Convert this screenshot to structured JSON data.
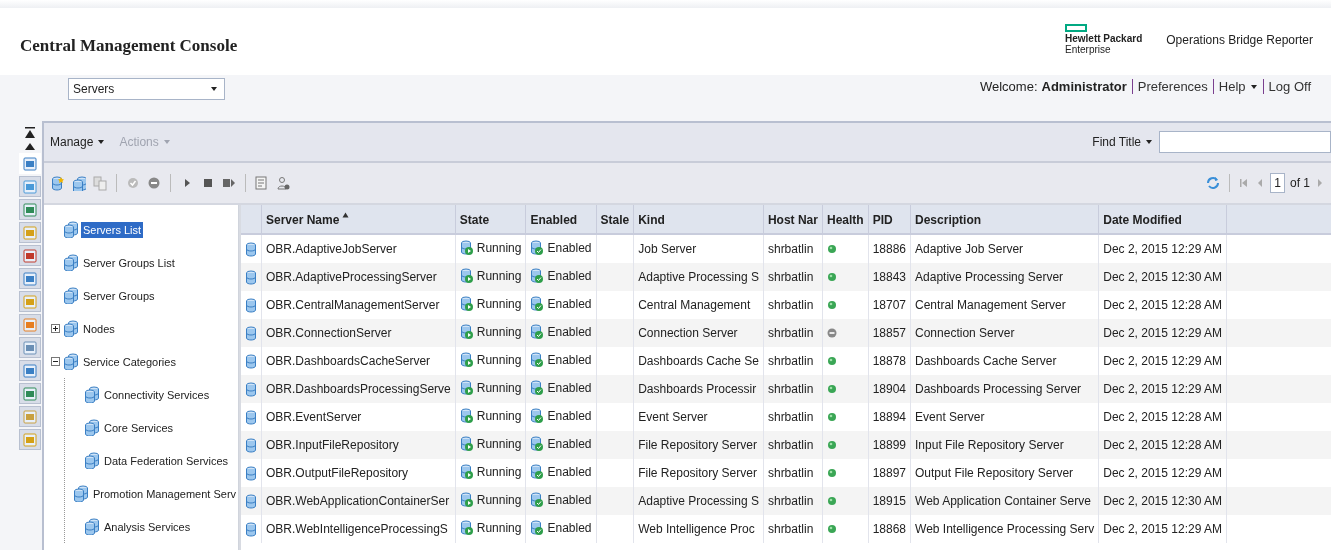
{
  "header": {
    "title": "Central Management Console",
    "brand_lines": [
      "Hewlett Packard",
      "Enterprise"
    ],
    "product": "Operations Bridge Reporter"
  },
  "area_select": {
    "value": "Servers"
  },
  "user_bar": {
    "welcome": "Welcome:",
    "user": "Administrator",
    "links": [
      {
        "label": "Preferences",
        "menu": false
      },
      {
        "label": "Help",
        "menu": true
      },
      {
        "label": "Log Off",
        "menu": false
      }
    ]
  },
  "menus": [
    {
      "label": "Manage",
      "disabled": false
    },
    {
      "label": "Actions",
      "disabled": true
    }
  ],
  "find": {
    "label": "Find Title"
  },
  "pager": {
    "page": "1",
    "total": "of 1"
  },
  "side_tabs": [
    {
      "selected": true
    },
    {
      "selected": false
    },
    {
      "selected": false
    },
    {
      "selected": false
    },
    {
      "selected": false
    },
    {
      "selected": false
    },
    {
      "selected": false
    },
    {
      "selected": false
    },
    {
      "selected": false
    },
    {
      "selected": false
    },
    {
      "selected": false
    },
    {
      "selected": false
    },
    {
      "selected": false
    }
  ],
  "tree": [
    {
      "label": "Servers List",
      "selected": true
    },
    {
      "label": "Server Groups List",
      "selected": false
    },
    {
      "label": "Server Groups",
      "selected": false
    },
    {
      "label": "Nodes",
      "selected": false,
      "expanded": false
    },
    {
      "label": "Service Categories",
      "selected": false,
      "expanded": true,
      "children": [
        {
          "label": "Connectivity Services",
          "selected": false
        },
        {
          "label": "Core Services",
          "selected": false
        },
        {
          "label": "Data Federation Services",
          "selected": false
        },
        {
          "label": "Promotion Management Serv",
          "selected": false
        },
        {
          "label": "Analysis Services",
          "selected": false
        }
      ]
    }
  ],
  "table": {
    "columns": [
      {
        "label": "Server Name",
        "sorted": true
      },
      {
        "label": "State"
      },
      {
        "label": "Enabled"
      },
      {
        "label": "Stale"
      },
      {
        "label": "Kind"
      },
      {
        "label": "Host Nar"
      },
      {
        "label": "Health"
      },
      {
        "label": "PID"
      },
      {
        "label": "Description"
      },
      {
        "label": "Date Modified"
      }
    ],
    "rows": [
      {
        "name": "OBR.AdaptiveJobServer",
        "state": "Running",
        "enabled": "Enabled",
        "kind": "Job Server",
        "host": "shrbatlin",
        "healthy": true,
        "pid": "18886",
        "description": "Adaptive Job Server",
        "modified": "Dec 2, 2015 12:29 AM"
      },
      {
        "name": "OBR.AdaptiveProcessingServer",
        "state": "Running",
        "enabled": "Enabled",
        "kind": "Adaptive Processing S",
        "host": "shrbatlin",
        "healthy": true,
        "pid": "18843",
        "description": "Adaptive Processing Server",
        "modified": "Dec 2, 2015 12:30 AM"
      },
      {
        "name": "OBR.CentralManagementServer",
        "state": "Running",
        "enabled": "Enabled",
        "kind": "Central Management",
        "host": "shrbatlin",
        "healthy": true,
        "pid": "18707",
        "description": "Central Management Server",
        "modified": "Dec 2, 2015 12:28 AM"
      },
      {
        "name": "OBR.ConnectionServer",
        "state": "Running",
        "enabled": "Enabled",
        "kind": "Connection Server",
        "host": "shrbatlin",
        "healthy": false,
        "pid": "18857",
        "description": "Connection Server",
        "modified": "Dec 2, 2015 12:29 AM"
      },
      {
        "name": "OBR.DashboardsCacheServer",
        "state": "Running",
        "enabled": "Enabled",
        "kind": "Dashboards Cache Se",
        "host": "shrbatlin",
        "healthy": true,
        "pid": "18878",
        "description": "Dashboards Cache Server",
        "modified": "Dec 2, 2015 12:29 AM"
      },
      {
        "name": "OBR.DashboardsProcessingServe",
        "state": "Running",
        "enabled": "Enabled",
        "kind": "Dashboards Processir",
        "host": "shrbatlin",
        "healthy": true,
        "pid": "18904",
        "description": "Dashboards Processing Server",
        "modified": "Dec 2, 2015 12:29 AM"
      },
      {
        "name": "OBR.EventServer",
        "state": "Running",
        "enabled": "Enabled",
        "kind": "Event Server",
        "host": "shrbatlin",
        "healthy": true,
        "pid": "18894",
        "description": "Event Server",
        "modified": "Dec 2, 2015 12:28 AM"
      },
      {
        "name": "OBR.InputFileRepository",
        "state": "Running",
        "enabled": "Enabled",
        "kind": "File Repository Server",
        "host": "shrbatlin",
        "healthy": true,
        "pid": "18899",
        "description": "Input File Repository Server",
        "modified": "Dec 2, 2015 12:28 AM"
      },
      {
        "name": "OBR.OutputFileRepository",
        "state": "Running",
        "enabled": "Enabled",
        "kind": "File Repository Server",
        "host": "shrbatlin",
        "healthy": true,
        "pid": "18897",
        "description": "Output File Repository Server",
        "modified": "Dec 2, 2015 12:29 AM"
      },
      {
        "name": "OBR.WebApplicationContainerSer",
        "state": "Running",
        "enabled": "Enabled",
        "kind": "Adaptive Processing S",
        "host": "shrbatlin",
        "healthy": true,
        "pid": "18915",
        "description": "Web Application Container Serve",
        "modified": "Dec 2, 2015 12:30 AM"
      },
      {
        "name": "OBR.WebIntelligenceProcessingS",
        "state": "Running",
        "enabled": "Enabled",
        "kind": "Web Intelligence Proc",
        "host": "shrbatlin",
        "healthy": true,
        "pid": "18868",
        "description": "Web Intelligence Processing Serv",
        "modified": "Dec 2, 2015 12:29 AM"
      }
    ]
  }
}
